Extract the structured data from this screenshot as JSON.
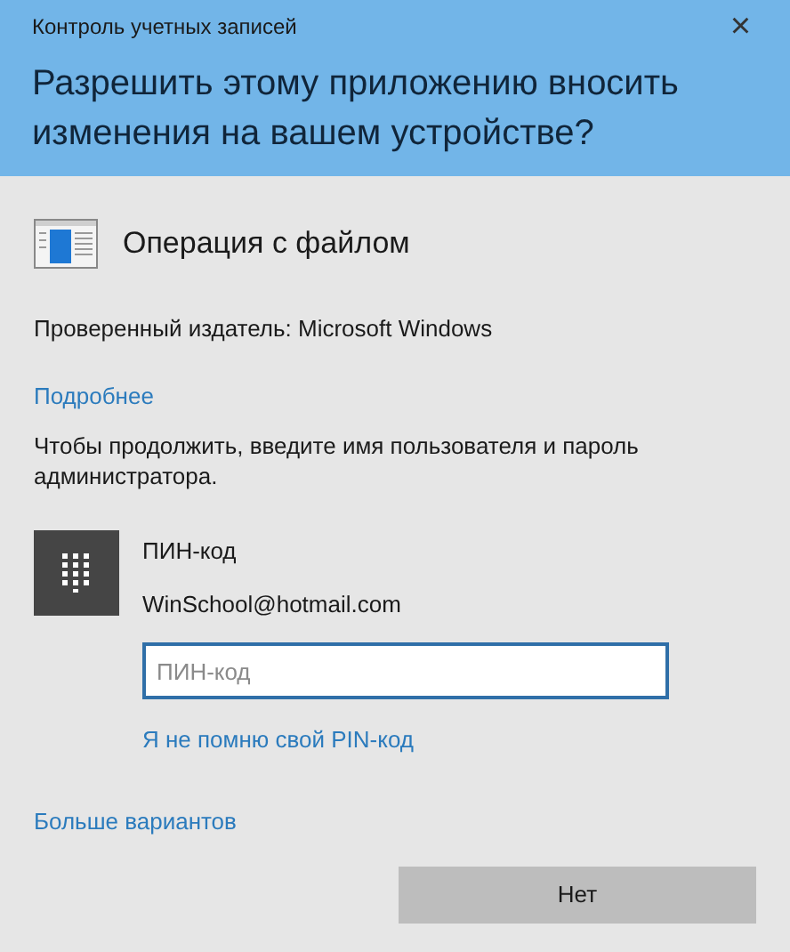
{
  "window": {
    "title": "Контроль учетных записей",
    "close": "×"
  },
  "question": "Разрешить этому приложению вносить изменения на вашем устройстве?",
  "app": {
    "name": "Операция с файлом"
  },
  "publisher": "Проверенный издатель: Microsoft Windows",
  "details_link": "Подробнее",
  "instruction": "Чтобы продолжить, введите имя пользователя и пароль администратора.",
  "account": {
    "method": "ПИН-код",
    "email": "WinSchool@hotmail.com"
  },
  "pin_field": {
    "placeholder": "ПИН-код"
  },
  "forgot_link": "Я не помню свой PIN-код",
  "more_link": "Больше вариантов",
  "buttons": [
    "Нет"
  ]
}
